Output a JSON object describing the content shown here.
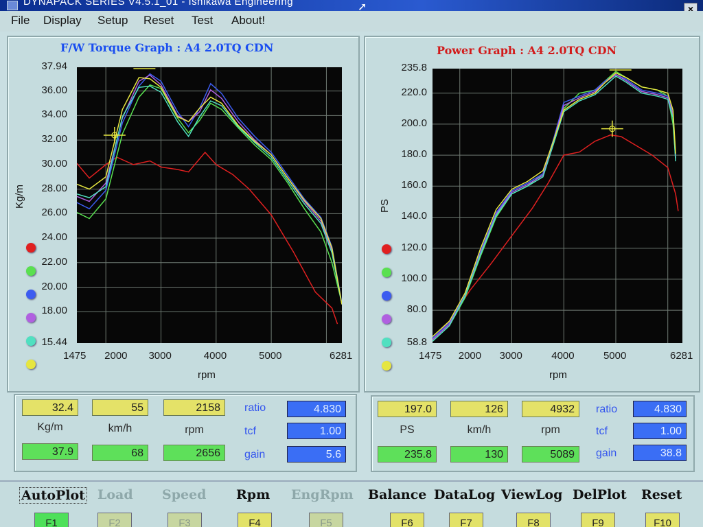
{
  "window": {
    "title": "DYNAPACK SERIES V4.5.1_01 - Ishikawa Engineering",
    "close_label": "×"
  },
  "menu": [
    "File",
    "Display",
    "Setup",
    "Reset",
    "Test",
    "About!"
  ],
  "left_panel": {
    "title": "F/W Torque Graph : A4 2.0TQ CDN",
    "title_color": "#1a4ef0",
    "ylabel": "Kg/m",
    "xlabel": "rpm",
    "yticks": [
      "37.94",
      "36.00",
      "34.00",
      "32.00",
      "30.00",
      "28.00",
      "26.00",
      "24.00",
      "22.00",
      "20.00",
      "18.00",
      "15.44"
    ],
    "xticks": [
      "1475",
      "2000",
      "3000",
      "4000",
      "5000",
      "6281"
    ],
    "readouts": {
      "y1": "32.4",
      "y2": "55",
      "y3": "2158",
      "u1": "Kg/m",
      "u2": "km/h",
      "u3": "rpm",
      "g1": "37.9",
      "g2": "68",
      "g3": "2656",
      "ratio_label": "ratio",
      "ratio_value": "4.830",
      "tcf_label": "tcf",
      "tcf_value": "1.00",
      "gain_label": "gain",
      "gain_value": "5.6"
    }
  },
  "right_panel": {
    "title": "Power Graph : A4 2.0TQ CDN",
    "title_color": "#d21a1a",
    "ylabel": "PS",
    "xlabel": "rpm",
    "yticks": [
      "235.8",
      "220.0",
      "200.0",
      "180.0",
      "160.0",
      "140.0",
      "120.0",
      "100.0",
      "80.0",
      "58.8"
    ],
    "xticks": [
      "1475",
      "2000",
      "3000",
      "4000",
      "5000",
      "6281"
    ],
    "readouts": {
      "y1": "197.0",
      "y2": "126",
      "y3": "4932",
      "u1": "PS",
      "u2": "km/h",
      "u3": "rpm",
      "g1": "235.8",
      "g2": "130",
      "g3": "5089",
      "ratio_label": "ratio",
      "ratio_value": "4.830",
      "tcf_label": "tcf",
      "tcf_value": "1.00",
      "gain_label": "gain",
      "gain_value": "38.8"
    }
  },
  "series_colors": [
    "#e02020",
    "#59e050",
    "#3c5cf0",
    "#b060e0",
    "#50e0c0",
    "#e6e640"
  ],
  "buttons": [
    {
      "label": "AutoPlot",
      "key": "F1",
      "enabled": true,
      "active": true
    },
    {
      "label": "Load",
      "key": "F2",
      "enabled": false,
      "active": false
    },
    {
      "label": "Speed",
      "key": "F3",
      "enabled": false,
      "active": false
    },
    {
      "label": "Rpm",
      "key": "F4",
      "enabled": true,
      "active": false
    },
    {
      "label": "EngRpm",
      "key": "F5",
      "enabled": false,
      "active": false
    },
    {
      "label": "Balance",
      "key": "F6",
      "enabled": true,
      "active": false
    },
    {
      "label": "DataLog",
      "key": "F7",
      "enabled": true,
      "active": false
    },
    {
      "label": "ViewLog",
      "key": "F8",
      "enabled": true,
      "active": false
    },
    {
      "label": "DelPlot",
      "key": "F9",
      "enabled": true,
      "active": false
    },
    {
      "label": "Reset",
      "key": "F10",
      "enabled": true,
      "active": false
    }
  ],
  "chart_data": [
    {
      "type": "line",
      "title": "F/W Torque Graph : A4 2.0TQ CDN",
      "xlabel": "rpm",
      "ylabel": "Kg/m",
      "xlim": [
        1475,
        6281
      ],
      "ylim": [
        15.44,
        37.94
      ],
      "grid": true,
      "series": [
        {
          "color": "#e02020",
          "x": [
            1475,
            1700,
            2000,
            2200,
            2500,
            2800,
            3000,
            3300,
            3500,
            3800,
            4000,
            4300,
            4600,
            5000,
            5400,
            5800,
            6100,
            6200
          ],
          "values": [
            30.1,
            28.9,
            30.0,
            30.6,
            30.0,
            30.3,
            29.8,
            29.6,
            29.4,
            31.0,
            30.0,
            29.2,
            28.0,
            25.9,
            22.9,
            19.6,
            18.3,
            17.0
          ]
        },
        {
          "color": "#59e050",
          "x": [
            1475,
            1700,
            2000,
            2300,
            2600,
            2800,
            3000,
            3300,
            3500,
            3700,
            3900,
            4100,
            4400,
            4700,
            5000,
            5300,
            5600,
            5900,
            6100,
            6281
          ],
          "values": [
            26.1,
            25.6,
            27.2,
            32.5,
            35.5,
            36.5,
            36.2,
            33.8,
            32.6,
            33.6,
            35.0,
            34.5,
            33.0,
            31.6,
            30.4,
            28.5,
            26.4,
            24.5,
            22.0,
            18.7
          ]
        },
        {
          "color": "#3c5cf0",
          "x": [
            1475,
            1700,
            2000,
            2300,
            2600,
            2800,
            3000,
            3300,
            3500,
            3700,
            3900,
            4100,
            4400,
            4700,
            5000,
            5300,
            5600,
            5900,
            6100,
            6281
          ],
          "values": [
            26.9,
            26.4,
            27.9,
            33.4,
            36.4,
            37.4,
            36.8,
            34.3,
            33.1,
            34.6,
            36.6,
            35.8,
            33.8,
            32.3,
            31.0,
            29.1,
            27.2,
            25.7,
            23.3,
            18.7
          ]
        },
        {
          "color": "#b060e0",
          "x": [
            1475,
            1700,
            2000,
            2300,
            2600,
            2800,
            3000,
            3300,
            3500,
            3700,
            3900,
            4100,
            4400,
            4700,
            5000,
            5300,
            5600,
            5900,
            6100,
            6281
          ],
          "values": [
            27.4,
            27.0,
            28.5,
            33.8,
            36.8,
            37.3,
            36.5,
            34.0,
            33.5,
            34.3,
            36.1,
            35.4,
            33.5,
            32.0,
            30.8,
            28.9,
            27.0,
            25.4,
            23.0,
            18.6
          ]
        },
        {
          "color": "#50e0c0",
          "x": [
            1475,
            1700,
            2000,
            2300,
            2600,
            2800,
            3000,
            3300,
            3500,
            3700,
            3900,
            4100,
            4400,
            4700,
            5000,
            5300,
            5600,
            5900,
            6100,
            6281
          ],
          "values": [
            27.6,
            27.3,
            28.2,
            33.9,
            36.3,
            36.4,
            35.9,
            33.5,
            32.3,
            33.9,
            35.2,
            34.8,
            33.1,
            31.8,
            30.6,
            28.7,
            26.8,
            25.2,
            22.8,
            18.6
          ]
        },
        {
          "color": "#e6e640",
          "x": [
            1475,
            1700,
            2000,
            2300,
            2600,
            2800,
            3000,
            3300,
            3500,
            3700,
            3900,
            4100,
            4400,
            4700,
            5000,
            5300,
            5600,
            5900,
            6100,
            6281
          ],
          "values": [
            28.4,
            28.0,
            29.0,
            34.5,
            37.1,
            37.0,
            36.3,
            33.9,
            33.5,
            34.6,
            35.5,
            35.0,
            33.2,
            31.9,
            30.8,
            28.9,
            27.1,
            25.6,
            23.2,
            18.6
          ]
        }
      ],
      "markers": [
        {
          "x": 2158,
          "y": 32.4
        },
        {
          "x": 2700,
          "y": 37.94
        }
      ]
    },
    {
      "type": "line",
      "title": "Power Graph : A4 2.0TQ CDN",
      "xlabel": "rpm",
      "ylabel": "PS",
      "xlim": [
        1475,
        6281
      ],
      "ylim": [
        58.8,
        235.8
      ],
      "grid": true,
      "series": [
        {
          "color": "#e02020",
          "x": [
            1475,
            1800,
            2200,
            2600,
            3000,
            3400,
            3700,
            4000,
            4300,
            4600,
            4900,
            5100,
            5400,
            5700,
            6000,
            6150,
            6200
          ],
          "values": [
            61,
            73,
            93,
            110,
            128,
            146,
            162,
            180,
            182,
            189,
            193,
            192,
            186,
            180,
            172,
            155,
            144
          ]
        },
        {
          "color": "#59e050",
          "x": [
            1475,
            1800,
            2100,
            2400,
            2700,
            3000,
            3300,
            3600,
            3800,
            4000,
            4300,
            4600,
            4800,
            5000,
            5200,
            5500,
            5800,
            6000,
            6100,
            6150
          ],
          "values": [
            60,
            70,
            88,
            115,
            140,
            155,
            160,
            168,
            190,
            210,
            220,
            222,
            228,
            234,
            230,
            224,
            222,
            218,
            200,
            178
          ]
        },
        {
          "color": "#3c5cf0",
          "x": [
            1475,
            1800,
            2100,
            2400,
            2700,
            3000,
            3300,
            3600,
            3800,
            4000,
            4300,
            4600,
            4800,
            5000,
            5200,
            5500,
            5800,
            6000,
            6100,
            6150
          ],
          "values": [
            62,
            72,
            90,
            118,
            143,
            157,
            162,
            168,
            190,
            214,
            218,
            222,
            228,
            232,
            229,
            222,
            220,
            218,
            207,
            180
          ]
        },
        {
          "color": "#b060e0",
          "x": [
            1475,
            1800,
            2100,
            2400,
            2700,
            3000,
            3300,
            3600,
            3800,
            4000,
            4300,
            4600,
            4800,
            5000,
            5200,
            5500,
            5800,
            6000,
            6100,
            6150
          ],
          "values": [
            61,
            71,
            89,
            117,
            142,
            156,
            161,
            167,
            189,
            212,
            217,
            221,
            227,
            232,
            228,
            221,
            219,
            217,
            206,
            178
          ]
        },
        {
          "color": "#50e0c0",
          "x": [
            1475,
            1800,
            2100,
            2400,
            2700,
            3000,
            3300,
            3600,
            3800,
            4000,
            4300,
            4600,
            4800,
            5000,
            5200,
            5500,
            5800,
            6000,
            6100,
            6150
          ],
          "values": [
            60,
            70,
            89,
            116,
            141,
            155,
            160,
            166,
            187,
            208,
            215,
            219,
            225,
            231,
            227,
            220,
            218,
            216,
            204,
            176
          ]
        },
        {
          "color": "#e6e640",
          "x": [
            1475,
            1800,
            2100,
            2400,
            2700,
            3000,
            3300,
            3600,
            3800,
            4000,
            4300,
            4600,
            4800,
            5000,
            5200,
            5500,
            5800,
            6000,
            6100,
            6150
          ],
          "values": [
            63,
            73,
            91,
            120,
            145,
            158,
            163,
            170,
            189,
            209,
            216,
            220,
            227,
            233,
            230,
            224,
            222,
            220,
            209,
            181
          ]
        }
      ],
      "markers": [
        {
          "x": 4932,
          "y": 197.0
        },
        {
          "x": 5089,
          "y": 235.8
        }
      ]
    }
  ]
}
